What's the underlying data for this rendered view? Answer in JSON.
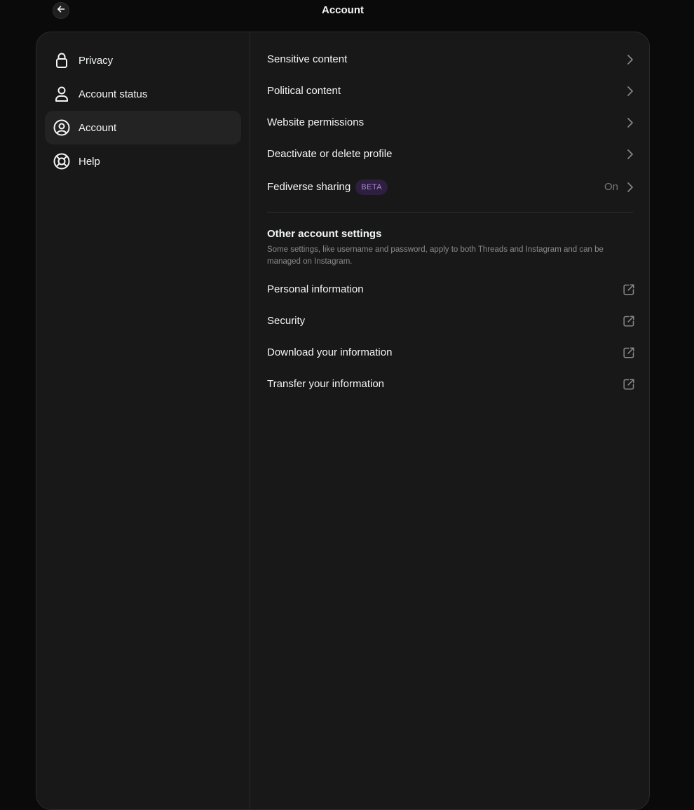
{
  "header": {
    "title": "Account"
  },
  "sidebar": {
    "items": [
      {
        "label": "Privacy",
        "icon": "lock-icon",
        "active": false
      },
      {
        "label": "Account status",
        "icon": "person-icon",
        "active": false
      },
      {
        "label": "Account",
        "icon": "account-circle-icon",
        "active": true
      },
      {
        "label": "Help",
        "icon": "lifebuoy-icon",
        "active": false
      }
    ]
  },
  "main": {
    "rows": [
      {
        "label": "Sensitive content",
        "trail": "chevron-right-icon"
      },
      {
        "label": "Political content",
        "trail": "chevron-right-icon"
      },
      {
        "label": "Website permissions",
        "trail": "chevron-right-icon"
      },
      {
        "label": "Deactivate or delete profile",
        "trail": "chevron-right-icon"
      },
      {
        "label": "Fediverse sharing",
        "badge": "BETA",
        "status": "On",
        "trail": "chevron-right-icon"
      }
    ],
    "other_section": {
      "title": "Other account settings",
      "description": "Some settings, like username and password, apply to both Threads and Instagram and can be managed on Instagram.",
      "links": [
        {
          "label": "Personal information",
          "trail": "external-link-icon"
        },
        {
          "label": "Security",
          "trail": "external-link-icon"
        },
        {
          "label": "Download your information",
          "trail": "external-link-icon"
        },
        {
          "label": "Transfer your information",
          "trail": "external-link-icon"
        }
      ]
    }
  },
  "colors": {
    "background": "#0a0a0a",
    "panel": "#181818",
    "active_item": "#232323",
    "text_primary": "#f3f5f7",
    "text_secondary": "#777777",
    "beta_badge_bg": "#2d1f3d",
    "beta_badge_text": "#a98ad3"
  }
}
